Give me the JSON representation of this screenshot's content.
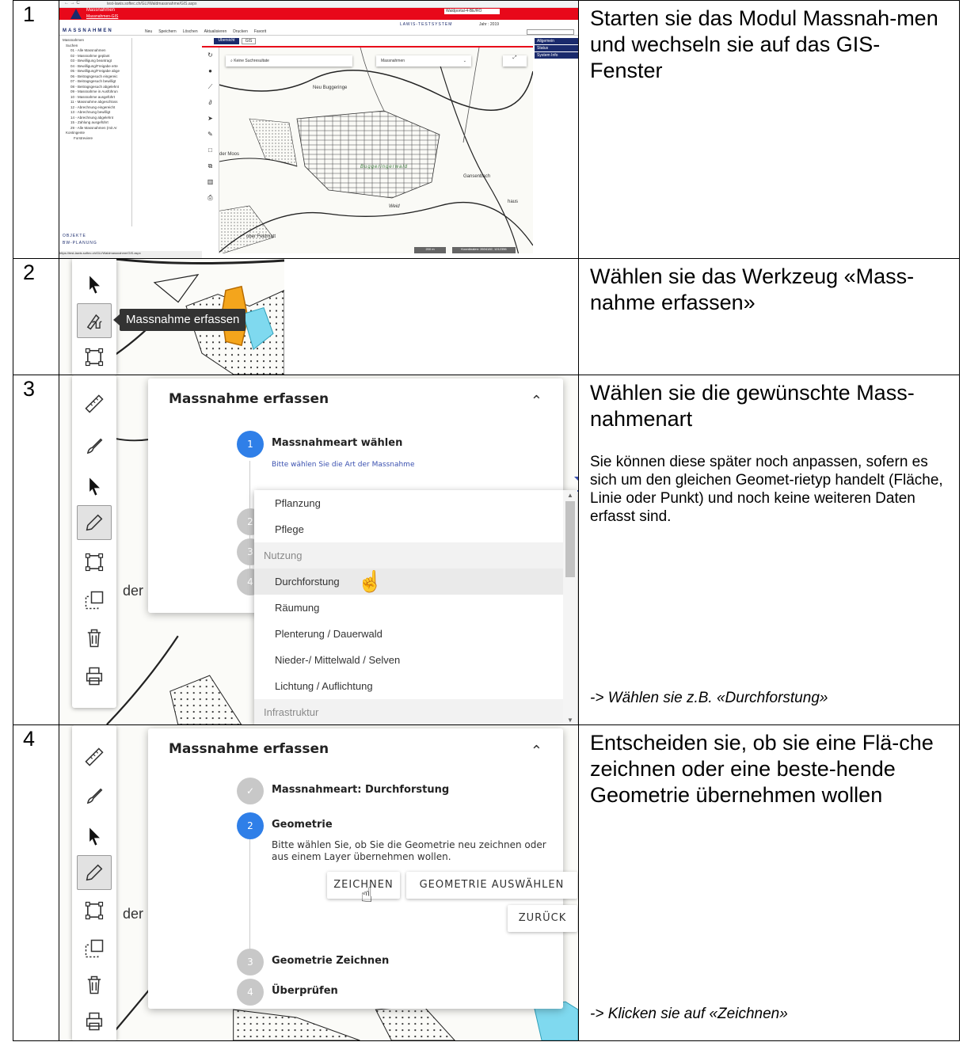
{
  "steps": [
    {
      "number": "1",
      "title": "Starten sie das Modul Massnah-men und wechseln sie auf das GIS-Fenster",
      "screenshot": {
        "url": "test-lawis.softec.ch/GLI/Waldmassnahme/GIS.aspx",
        "header_title": "Massnahmen",
        "header_sub": "Massnahmen-GIS",
        "portal_select": "Waldportal-4-BE/RO",
        "system_name": "LAWIS-TESTSYSTEM",
        "year": "Jahr : 2019",
        "module_name": "MASSNAHMEN",
        "toolbar": [
          "Neu",
          "Speichern",
          "Löschen",
          "Aktualisieren",
          "Drucken",
          "Favorit"
        ],
        "tabs": [
          "Übersicht",
          "GIS"
        ],
        "right_menu": [
          "Allgemein",
          "Status",
          "System Info"
        ],
        "tree_root": "Massnahmen",
        "tree_group": "Suchen",
        "tree_items": [
          "01 - Alle Massnahmen",
          "02 - Massnahme geplant",
          "03 - Bewilligung beantragt",
          "04 - Bewilligung/Freigabe erte",
          "05 - Bewilligung/Freigabe abge",
          "06 - Beitragsgesuch eingereic",
          "07 - Beitragsgesuch bewilligt",
          "08 - Beitragsgesuch abgelehnt",
          "09 - Massnahme in Ausführun",
          "10 - Massnahme ausgeführt",
          "11 - Massnahme abgeschloss",
          "12 - Abrechnung eingereicht",
          "13 - Abrechnung bewilligt",
          "14 - Abrechnung abgelehnt",
          "15 - Zahlung ausgeführt",
          "29 - Alle Massnahmen (mit Ar"
        ],
        "tree_group2": "Kontingente",
        "tree_item2": "Forstreviere",
        "search_placeholder": "Keine Suchresultate",
        "layer_select": "Massnahmen",
        "nav_bottom": [
          "OBJEKTE",
          "BW-PLANUNG"
        ],
        "status_url": "https://test-lawis.softec.ch/GLI/Waldmassnahme/GIS.aspx",
        "map_labels": [
          "Neu Buggeringe",
          "Buggeringerwald",
          "Gansenbach",
          "Weid",
          "der Moos",
          "ober Feldmatt",
          "haus"
        ],
        "scale": "200 m",
        "coords": "Koordinaten: 2604182, 1212396"
      }
    },
    {
      "number": "2",
      "title": "Wählen sie das Werkzeug «Mass-nahme erfassen»",
      "tooltip": "Massnahme erfassen"
    },
    {
      "number": "3",
      "title": "Wählen sie die gewünschte Mass-nahmenart",
      "note": "Sie können diese später noch anpassen, sofern es sich um den gleichen Geomet-rietyp handelt (Fläche, Linie oder Punkt) und noch keine weiteren Daten erfasst sind.",
      "hint": "-> Wählen sie z.B. «Durchforstung»",
      "panel": {
        "title": "Massnahme erfassen",
        "step1_label": "Massnahmeart wählen",
        "select_label": "Bitte wählen Sie die Art der Massnahme",
        "step_numbers": [
          "1",
          "2",
          "3",
          "4"
        ],
        "options": [
          {
            "label": "Pflanzung",
            "group": false
          },
          {
            "label": "Pflege",
            "group": false
          },
          {
            "label": "Nutzung",
            "group": true
          },
          {
            "label": "Durchforstung",
            "group": false
          },
          {
            "label": "Räumung",
            "group": false
          },
          {
            "label": "Plenterung / Dauerwald",
            "group": false
          },
          {
            "label": "Nieder-/ Mittelwald / Selven",
            "group": false
          },
          {
            "label": "Lichtung / Auflichtung",
            "group": false
          },
          {
            "label": "Infrastruktur",
            "group": true
          }
        ],
        "map_label": "der"
      }
    },
    {
      "number": "4",
      "title": "Entscheiden sie, ob sie eine Flä-che zeichnen oder eine beste-hende Geometrie übernehmen wollen",
      "hint": "-> Klicken sie auf «Zeichnen»",
      "panel": {
        "title": "Massnahme erfassen",
        "step1_check": "✓",
        "step1_label": "Massnahmeart: Durchforstung",
        "step2_number": "2",
        "step2_label": "Geometrie",
        "step2_text": "Bitte wählen Sie, ob Sie die Geometrie neu zeichnen oder aus einem Layer übernehmen wollen.",
        "btn_draw": "ZEICHNEN",
        "btn_select": "GEOMETRIE AUSWÄHLEN",
        "btn_back": "ZURÜCK",
        "step3_number": "3",
        "step3_label": "Geometrie Zeichnen",
        "step4_number": "4",
        "step4_label": "Überprüfen",
        "map_label": "der"
      }
    }
  ],
  "colors": {
    "accent": "#2f7fe8",
    "header_red": "#e8081a",
    "polygon_orange": "#f4a51c",
    "polygon_cyan": "#7fd9ef"
  }
}
